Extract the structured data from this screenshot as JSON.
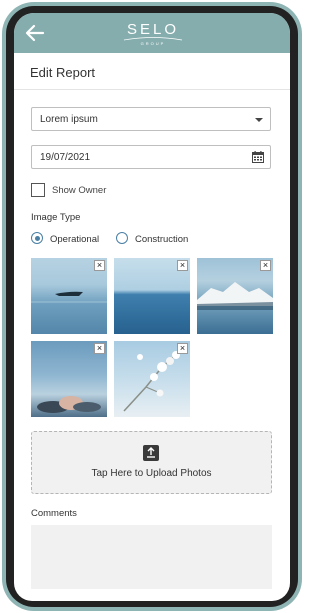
{
  "header": {
    "logo_text": "SELO",
    "logo_subtext": "GROUP"
  },
  "page": {
    "title": "Edit Report"
  },
  "form": {
    "dropdown_value": "Lorem ipsum",
    "date_value": "19/07/2021",
    "show_owner_label": "Show Owner",
    "show_owner_checked": false,
    "image_type_label": "Image Type",
    "image_type_options": [
      "Operational",
      "Construction"
    ],
    "image_type_selected": "Operational",
    "remove_symbol": "×",
    "upload_label": "Tap Here to Upload Photos",
    "comments_label": "Comments",
    "comments_value": ""
  },
  "images": [
    {
      "subject": "boat on water"
    },
    {
      "subject": "calm sea horizon"
    },
    {
      "subject": "snowy mountains over water"
    },
    {
      "subject": "sky with sunset clouds"
    },
    {
      "subject": "white blossom branch"
    }
  ],
  "colors": {
    "header_bg": "#86adad",
    "frame": "#8fb4b4",
    "radio_accent": "#4a7fa5"
  },
  "icons": {
    "back": "arrow-left-icon",
    "calendar": "calendar-icon",
    "upload": "upload-icon",
    "caret": "chevron-down-icon"
  }
}
